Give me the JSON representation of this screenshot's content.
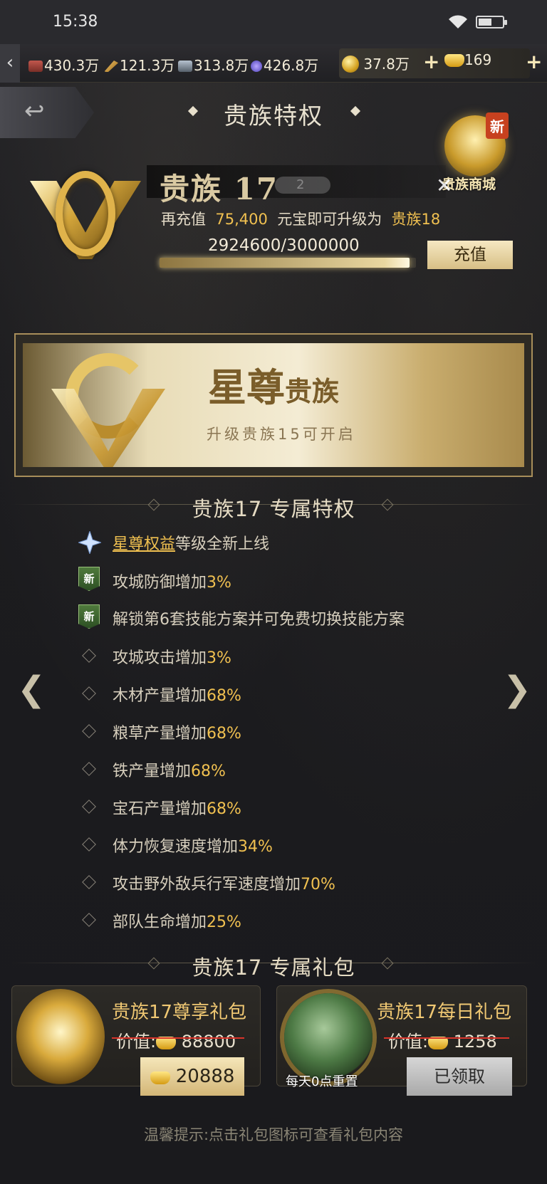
{
  "status_bar": {
    "time": "15:38"
  },
  "resources": [
    {
      "icon": "wood-icon",
      "value": "430.3万"
    },
    {
      "icon": "grain-icon",
      "value": "121.3万"
    },
    {
      "icon": "iron-icon",
      "value": "313.8万"
    },
    {
      "icon": "gem-icon",
      "value": "426.8万"
    },
    {
      "icon": "coin-icon",
      "value": "37.8万"
    },
    {
      "icon": "ingot-icon",
      "value": "169"
    }
  ],
  "header": {
    "title": "贵族特权"
  },
  "shop": {
    "badge": "新",
    "label": "贵族商城"
  },
  "vip": {
    "level_name": "贵族 17",
    "extra_count": "2",
    "upgrade_prefix": "再充值",
    "upgrade_amount": "75,400",
    "upgrade_middle": "元宝即可升级为",
    "upgrade_target": "贵族18",
    "progress_text": "2924600/3000000",
    "progress_fraction": 0.975,
    "recharge_label": "充值"
  },
  "banner": {
    "title_main": "星尊",
    "title_sub": "贵族",
    "hint": "升级贵族15可开启"
  },
  "privileges_section": {
    "title": "贵族17  专属特权"
  },
  "privileges": [
    {
      "marker": "star",
      "link": "星尊权益",
      "text": "等级全新上线",
      "pct": ""
    },
    {
      "marker": "new",
      "text": "攻城防御增加",
      "pct": "3%"
    },
    {
      "marker": "new",
      "text": "解锁第6套技能方案并可免费切换技能方案",
      "pct": ""
    },
    {
      "marker": "diamond",
      "text": "攻城攻击增加",
      "pct": "3%"
    },
    {
      "marker": "diamond",
      "text": "木材产量增加",
      "pct": "68%"
    },
    {
      "marker": "diamond",
      "text": "粮草产量增加",
      "pct": "68%"
    },
    {
      "marker": "diamond",
      "text": "铁产量增加",
      "pct": "68%"
    },
    {
      "marker": "diamond",
      "text": "宝石产量增加",
      "pct": "68%"
    },
    {
      "marker": "diamond",
      "text": "体力恢复速度增加",
      "pct": "34%"
    },
    {
      "marker": "diamond",
      "text": "攻击野外敌兵行军速度增加",
      "pct": "70%"
    },
    {
      "marker": "diamond",
      "text": "部队生命增加",
      "pct": "25%"
    }
  ],
  "new_badge_text": "新",
  "gifts_section": {
    "title": "贵族17  专属礼包"
  },
  "gifts": [
    {
      "name": "贵族17尊享礼包",
      "value_label": "价值:",
      "value": "88800",
      "price": "20888"
    },
    {
      "name": "贵族17每日礼包",
      "value_label": "价值:",
      "value": "1258",
      "button": "已领取",
      "note": "每天0点重置"
    }
  ],
  "tip": "温馨提示:点击礼包图标可查看礼包内容",
  "colors": {
    "accent_gold": "#f0c050",
    "background": "#1b1b1e",
    "strike": "#d9342a"
  }
}
